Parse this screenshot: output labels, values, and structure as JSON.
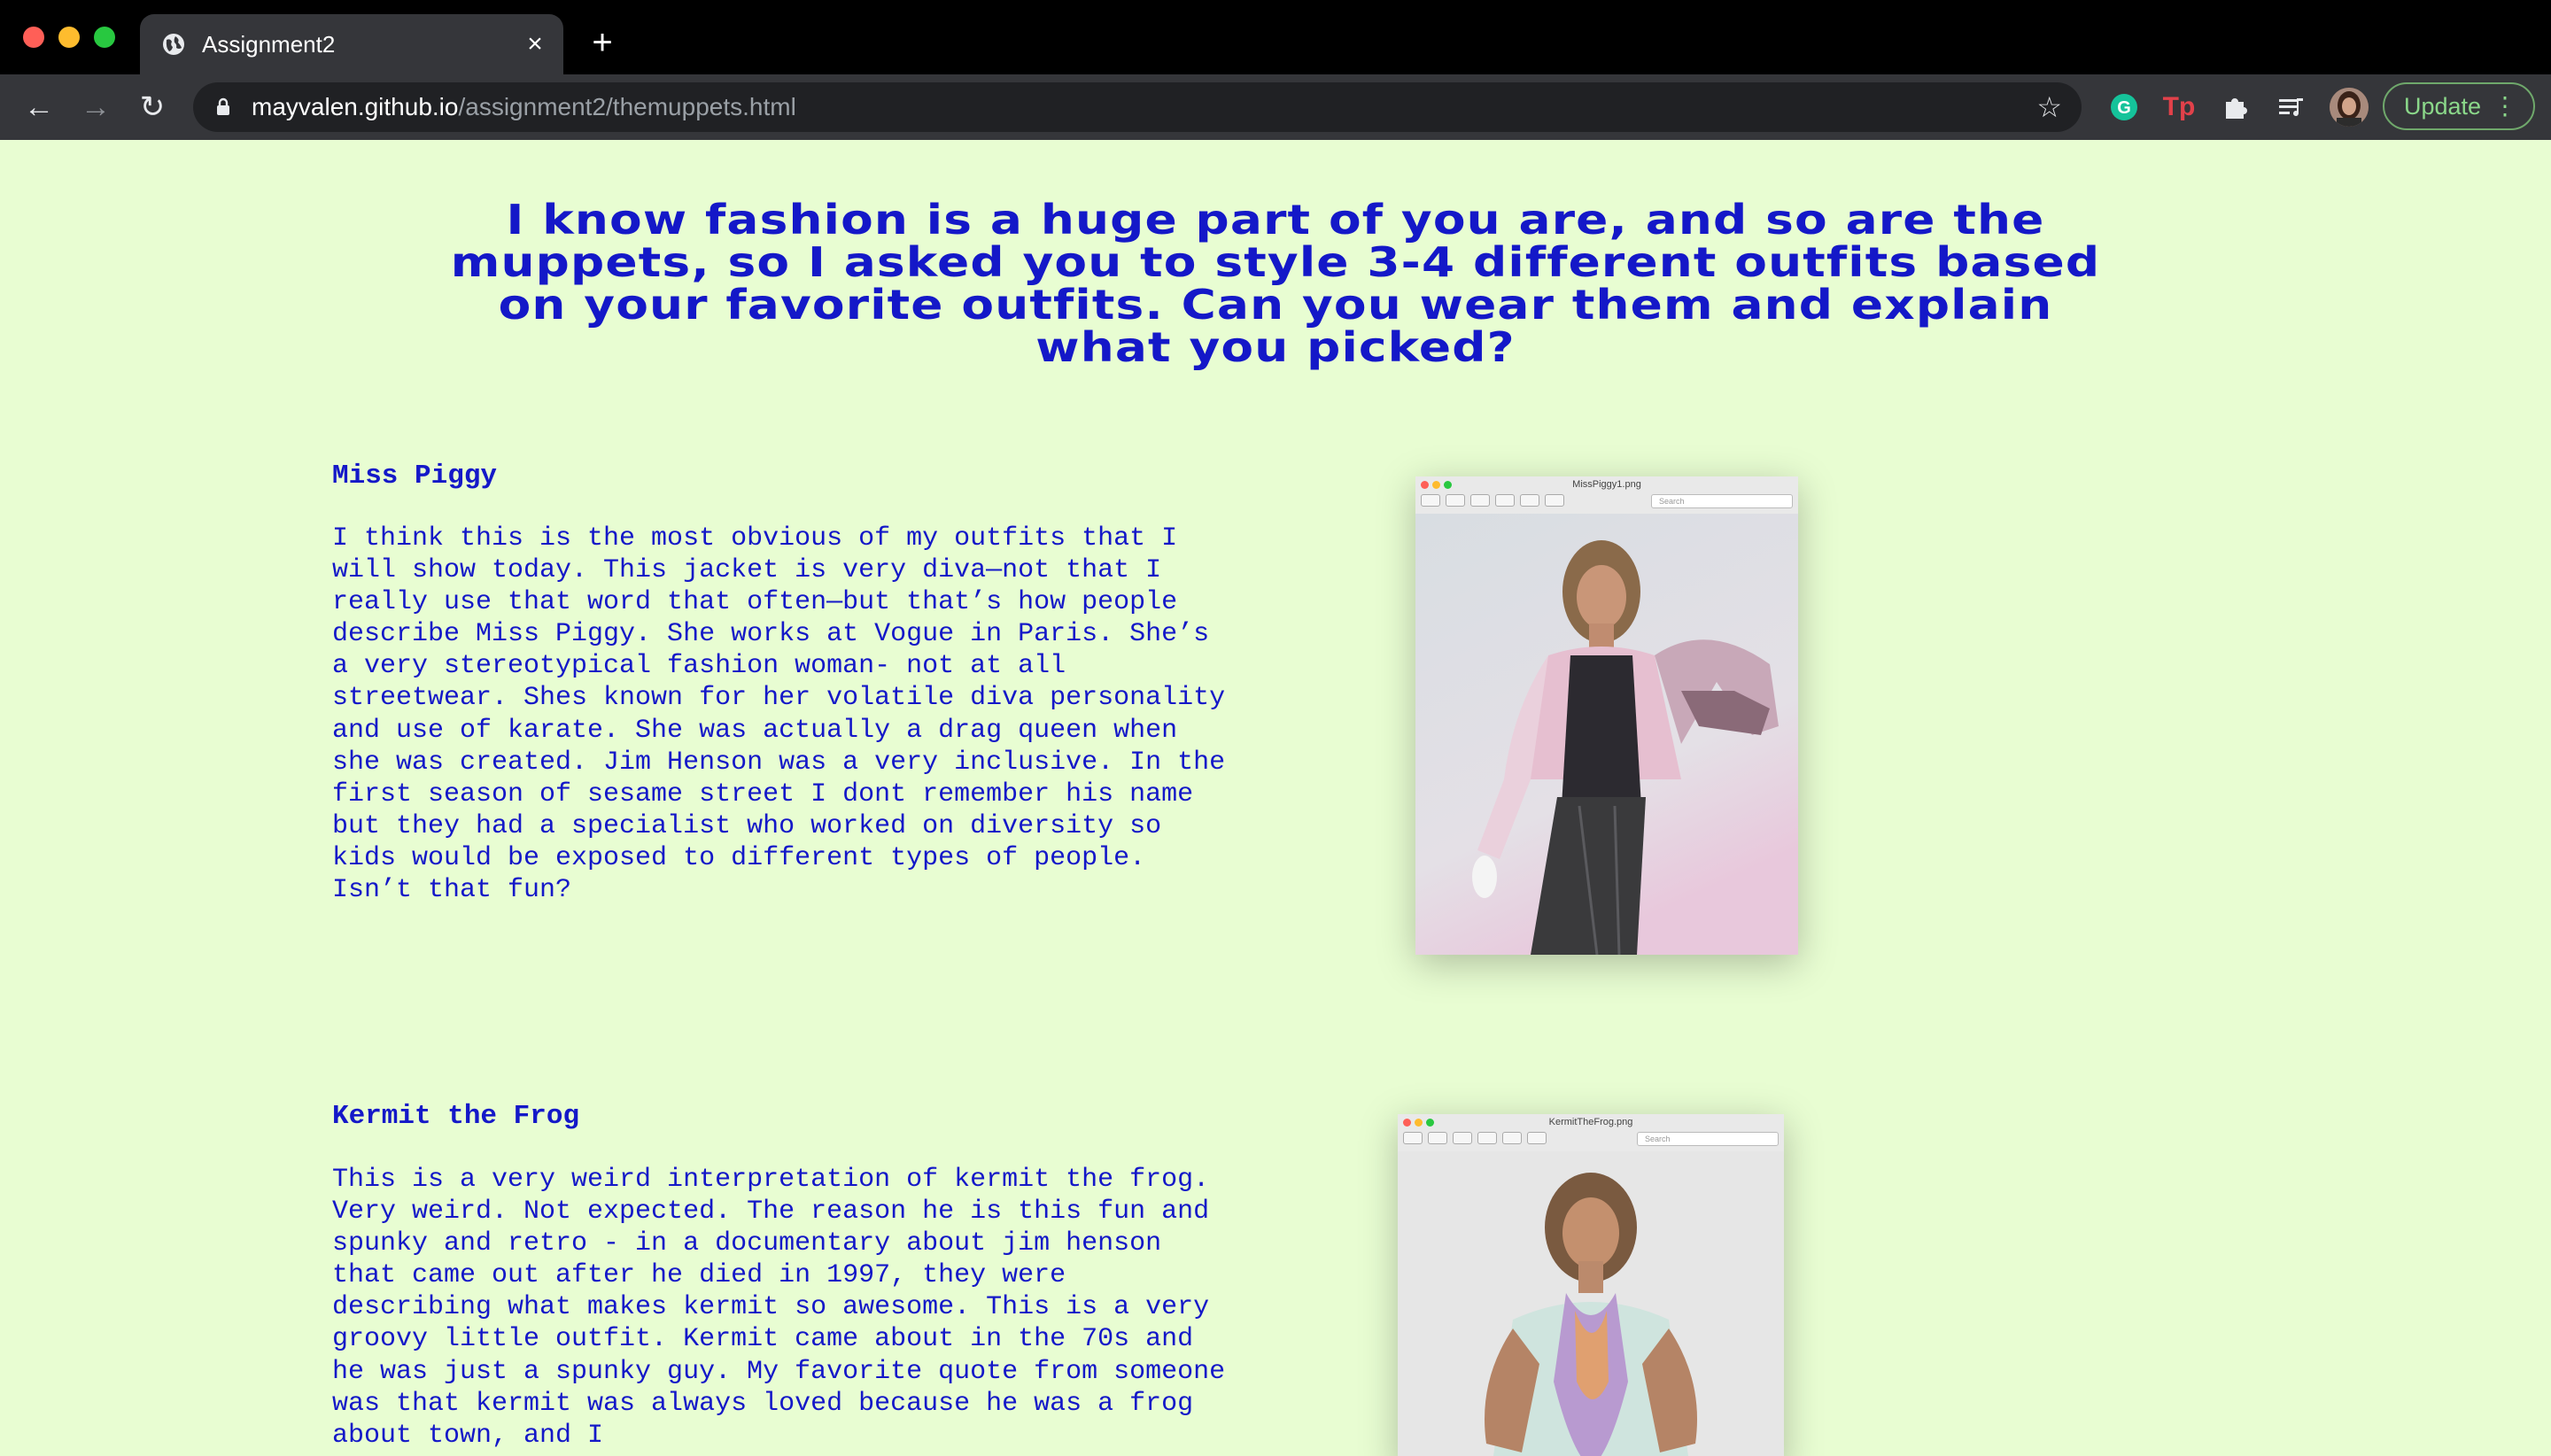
{
  "browser": {
    "tab_title": "Assignment2",
    "url_host": "mayvalen.github.io",
    "url_path": "/assignment2/themuppets.html",
    "update_label": "Update",
    "extensions": [
      "grammarly-icon",
      "tp-icon",
      "puzzle-icon",
      "media-icon"
    ],
    "tp_label": "Tp"
  },
  "page": {
    "heading": "I know fashion is a huge part of you are, and so are the muppets, so I asked you to style 3-4 different outfits based on your favorite outfits. Can you wear them and explain what you picked?",
    "sections": [
      {
        "title": "Miss Piggy",
        "body": "I think this is the most obvious of my outfits that I will show today. This jacket is very diva—not that I really use that word that often—but that’s how people describe Miss Piggy. She works at Vogue in Paris. She’s a very stereotypical fashion woman- not at all streetwear. Shes known for her volatile diva personality and use of karate. She was actually a drag queen when she was created. Jim Henson was a very inclusive. In the first season of sesame street I dont remember his name but they had a specialist who worked on diversity so kids would be exposed to different types of people. Isn’t that fun?",
        "image_filename": "MissPiggy1.png",
        "search_placeholder": "Search"
      },
      {
        "title": "Kermit the Frog",
        "body": "This is a very weird interpretation of kermit the frog. Very weird. Not expected. The reason he is this fun and spunky and retro - in a documentary about jim henson that came out after he died in 1997, they were describing what makes kermit so awesome. This is a very groovy little outfit. Kermit came about in the 70s and he was just a spunky guy. My favorite quote from someone was that kermit was always loved because he was a frog about town, and I",
        "image_filename": "KermitTheFrog.png",
        "search_placeholder": "Search"
      }
    ]
  },
  "colors": {
    "page_background": "#e8fdd2",
    "text_blue": "#1418c8",
    "chrome_dark": "#35363a"
  }
}
